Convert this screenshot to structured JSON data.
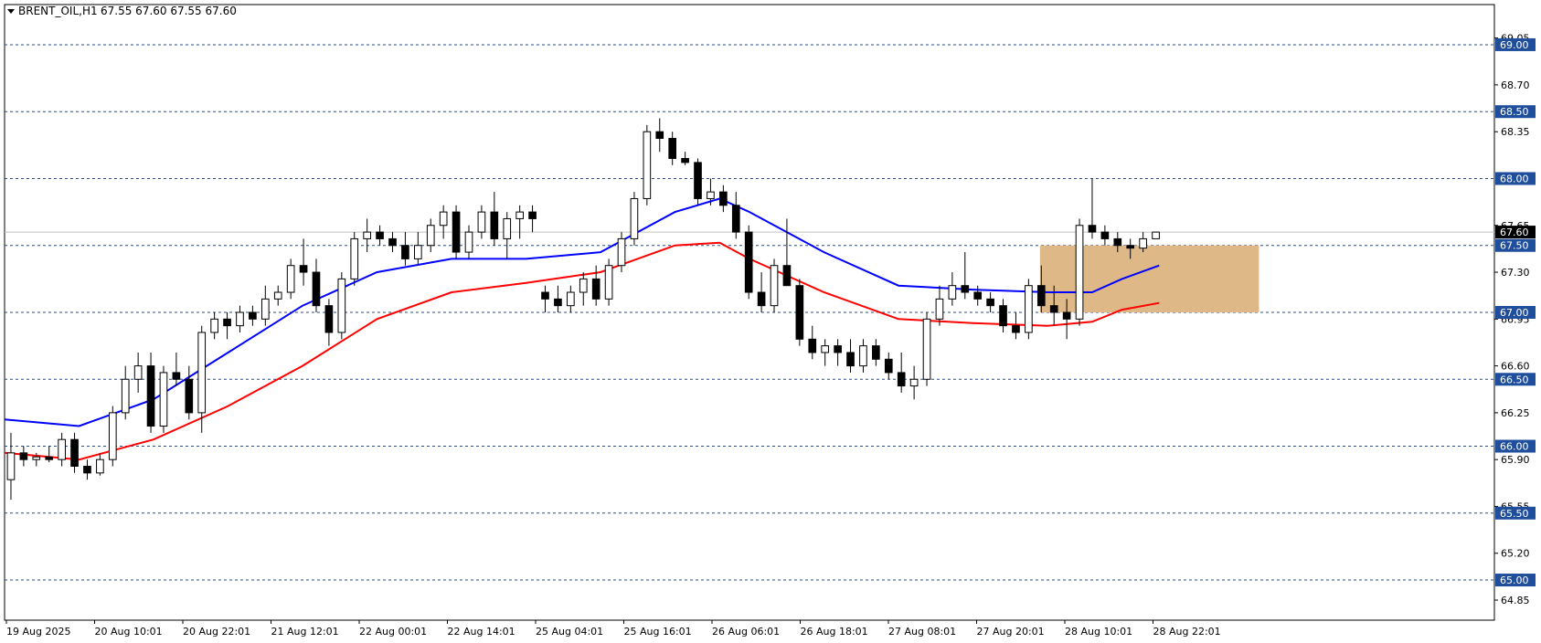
{
  "header": {
    "symbol_label": "BRENT_OIL,H1",
    "ohlc_label": "67.55 67.60 67.55 67.60",
    "dropdown_icon": "triangle-down-icon"
  },
  "chart_data": {
    "type": "candlestick",
    "y_range": [
      64.7,
      69.3
    ],
    "y_ticks": [
      "69.05",
      "68.70",
      "68.35",
      "67.65",
      "67.30",
      "66.95",
      "66.60",
      "66.25",
      "65.90",
      "65.55",
      "65.20",
      "64.85"
    ],
    "x_ticks": [
      "19 Aug 2025",
      "20 Aug 10:01",
      "20 Aug 22:01",
      "21 Aug 12:01",
      "22 Aug 00:01",
      "22 Aug 14:01",
      "25 Aug 04:01",
      "25 Aug 16:01",
      "26 Aug 06:01",
      "26 Aug 18:01",
      "27 Aug 08:01",
      "27 Aug 20:01",
      "28 Aug 10:01",
      "28 Aug 22:01"
    ],
    "levels": [
      {
        "value": 69.0,
        "label": "69.00"
      },
      {
        "value": 68.5,
        "label": "68.50"
      },
      {
        "value": 68.0,
        "label": "68.00"
      },
      {
        "value": 67.5,
        "label": "67.50"
      },
      {
        "value": 67.0,
        "label": "67.00"
      },
      {
        "value": 66.5,
        "label": "66.50"
      },
      {
        "value": 66.0,
        "label": "66.00"
      },
      {
        "value": 65.5,
        "label": "65.50"
      },
      {
        "value": 65.0,
        "label": "65.00"
      }
    ],
    "current_price": {
      "value": 67.6,
      "label": "67.60"
    },
    "zone": {
      "x_start": 0.695,
      "x_end": 0.842,
      "y_top": 67.5,
      "y_bottom": 67.0,
      "color": "#deb887"
    },
    "colors": {
      "grid": "#1f4e9c",
      "blue_ma": "#0000ff",
      "red_ma": "#ff0000",
      "current_line": "#c0c0c0",
      "label_bg": "#1f4e9c",
      "current_label_bg": "#000000"
    },
    "candles": [
      [
        65.75,
        66.1,
        65.6,
        65.95
      ],
      [
        65.95,
        66.0,
        65.85,
        65.9
      ],
      [
        65.9,
        65.95,
        65.85,
        65.92
      ],
      [
        65.92,
        66.0,
        65.88,
        65.9
      ],
      [
        65.9,
        66.1,
        65.85,
        66.05
      ],
      [
        66.05,
        66.1,
        65.8,
        65.85
      ],
      [
        65.85,
        65.9,
        65.75,
        65.8
      ],
      [
        65.8,
        65.95,
        65.78,
        65.9
      ],
      [
        65.9,
        66.3,
        65.85,
        66.25
      ],
      [
        66.25,
        66.6,
        66.2,
        66.5
      ],
      [
        66.5,
        66.7,
        66.4,
        66.6
      ],
      [
        66.6,
        66.7,
        66.1,
        66.15
      ],
      [
        66.15,
        66.6,
        66.1,
        66.55
      ],
      [
        66.55,
        66.7,
        66.45,
        66.5
      ],
      [
        66.5,
        66.6,
        66.2,
        66.25
      ],
      [
        66.25,
        66.9,
        66.1,
        66.85
      ],
      [
        66.85,
        67.0,
        66.8,
        66.95
      ],
      [
        66.95,
        67.0,
        66.8,
        66.9
      ],
      [
        66.9,
        67.05,
        66.85,
        67.0
      ],
      [
        67.0,
        67.05,
        66.9,
        66.95
      ],
      [
        66.95,
        67.2,
        66.9,
        67.1
      ],
      [
        67.1,
        67.2,
        67.05,
        67.15
      ],
      [
        67.15,
        67.4,
        67.1,
        67.35
      ],
      [
        67.35,
        67.55,
        67.2,
        67.3
      ],
      [
        67.3,
        67.4,
        67.0,
        67.05
      ],
      [
        67.05,
        67.1,
        66.75,
        66.85
      ],
      [
        66.85,
        67.3,
        66.8,
        67.25
      ],
      [
        67.25,
        67.6,
        67.2,
        67.55
      ],
      [
        67.55,
        67.7,
        67.45,
        67.6
      ],
      [
        67.6,
        67.65,
        67.5,
        67.55
      ],
      [
        67.55,
        67.6,
        67.45,
        67.5
      ],
      [
        67.5,
        67.6,
        67.35,
        67.4
      ],
      [
        67.4,
        67.6,
        67.35,
        67.5
      ],
      [
        67.5,
        67.7,
        67.45,
        67.65
      ],
      [
        67.65,
        67.8,
        67.55,
        67.75
      ],
      [
        67.75,
        67.8,
        67.4,
        67.45
      ],
      [
        67.45,
        67.65,
        67.4,
        67.6
      ],
      [
        67.6,
        67.8,
        67.55,
        67.75
      ],
      [
        67.75,
        67.9,
        67.5,
        67.55
      ],
      [
        67.55,
        67.75,
        67.4,
        67.7
      ],
      [
        67.7,
        67.8,
        67.55,
        67.75
      ],
      [
        67.75,
        67.8,
        67.6,
        67.7
      ],
      [
        67.15,
        67.2,
        67.0,
        67.1
      ],
      [
        67.1,
        67.2,
        67.0,
        67.05
      ],
      [
        67.05,
        67.2,
        67.0,
        67.15
      ],
      [
        67.15,
        67.3,
        67.05,
        67.25
      ],
      [
        67.25,
        67.35,
        67.05,
        67.1
      ],
      [
        67.1,
        67.4,
        67.05,
        67.35
      ],
      [
        67.35,
        67.6,
        67.3,
        67.55
      ],
      [
        67.55,
        67.9,
        67.5,
        67.85
      ],
      [
        67.85,
        68.4,
        67.8,
        68.35
      ],
      [
        68.35,
        68.45,
        68.2,
        68.3
      ],
      [
        68.3,
        68.35,
        68.1,
        68.15
      ],
      [
        68.15,
        68.2,
        68.1,
        68.12
      ],
      [
        68.12,
        68.15,
        67.8,
        67.85
      ],
      [
        67.85,
        68.0,
        67.8,
        67.9
      ],
      [
        67.9,
        67.95,
        67.75,
        67.8
      ],
      [
        67.8,
        67.9,
        67.55,
        67.6
      ],
      [
        67.6,
        67.65,
        67.1,
        67.15
      ],
      [
        67.15,
        67.3,
        67.0,
        67.05
      ],
      [
        67.05,
        67.4,
        67.0,
        67.35
      ],
      [
        67.35,
        67.7,
        67.3,
        67.2
      ],
      [
        67.2,
        67.25,
        66.75,
        66.8
      ],
      [
        66.8,
        66.9,
        66.65,
        66.7
      ],
      [
        66.7,
        66.8,
        66.6,
        66.75
      ],
      [
        66.75,
        66.8,
        66.6,
        66.7
      ],
      [
        66.7,
        66.8,
        66.55,
        66.6
      ],
      [
        66.6,
        66.8,
        66.55,
        66.75
      ],
      [
        66.75,
        66.8,
        66.6,
        66.65
      ],
      [
        66.65,
        66.7,
        66.5,
        66.55
      ],
      [
        66.55,
        66.7,
        66.4,
        66.45
      ],
      [
        66.45,
        66.6,
        66.35,
        66.5
      ],
      [
        66.5,
        67.0,
        66.45,
        66.95
      ],
      [
        66.95,
        67.2,
        66.9,
        67.1
      ],
      [
        67.1,
        67.3,
        67.05,
        67.2
      ],
      [
        67.2,
        67.45,
        67.1,
        67.15
      ],
      [
        67.15,
        67.2,
        67.05,
        67.1
      ],
      [
        67.1,
        67.15,
        67.0,
        67.05
      ],
      [
        67.05,
        67.1,
        66.85,
        66.9
      ],
      [
        66.9,
        67.0,
        66.8,
        66.85
      ],
      [
        66.85,
        67.25,
        66.8,
        67.2
      ],
      [
        67.2,
        67.35,
        67.0,
        67.05
      ],
      [
        67.05,
        67.2,
        66.9,
        67.0
      ],
      [
        67.0,
        67.1,
        66.8,
        66.95
      ],
      [
        66.95,
        67.7,
        66.9,
        67.65
      ],
      [
        67.65,
        68.0,
        67.55,
        67.6
      ],
      [
        67.6,
        67.65,
        67.5,
        67.55
      ],
      [
        67.55,
        67.6,
        67.45,
        67.5
      ],
      [
        67.5,
        67.55,
        67.4,
        67.48
      ],
      [
        67.48,
        67.6,
        67.45,
        67.55
      ],
      [
        67.55,
        67.6,
        67.55,
        67.6
      ]
    ],
    "blue_ma": [
      [
        0.0,
        66.2
      ],
      [
        0.05,
        66.15
      ],
      [
        0.1,
        66.35
      ],
      [
        0.15,
        66.7
      ],
      [
        0.2,
        67.05
      ],
      [
        0.25,
        67.3
      ],
      [
        0.3,
        67.4
      ],
      [
        0.35,
        67.4
      ],
      [
        0.4,
        67.45
      ],
      [
        0.45,
        67.75
      ],
      [
        0.48,
        67.85
      ],
      [
        0.5,
        67.75
      ],
      [
        0.55,
        67.45
      ],
      [
        0.6,
        67.2
      ],
      [
        0.65,
        67.17
      ],
      [
        0.7,
        67.15
      ],
      [
        0.73,
        67.15
      ],
      [
        0.75,
        67.25
      ],
      [
        0.775,
        67.35
      ]
    ],
    "red_ma": [
      [
        0.0,
        65.95
      ],
      [
        0.05,
        65.9
      ],
      [
        0.1,
        66.05
      ],
      [
        0.15,
        66.3
      ],
      [
        0.2,
        66.6
      ],
      [
        0.25,
        66.95
      ],
      [
        0.3,
        67.15
      ],
      [
        0.35,
        67.22
      ],
      [
        0.4,
        67.3
      ],
      [
        0.45,
        67.5
      ],
      [
        0.48,
        67.52
      ],
      [
        0.5,
        67.4
      ],
      [
        0.55,
        67.15
      ],
      [
        0.6,
        66.95
      ],
      [
        0.65,
        66.92
      ],
      [
        0.7,
        66.9
      ],
      [
        0.73,
        66.93
      ],
      [
        0.75,
        67.02
      ],
      [
        0.775,
        67.07
      ]
    ]
  }
}
